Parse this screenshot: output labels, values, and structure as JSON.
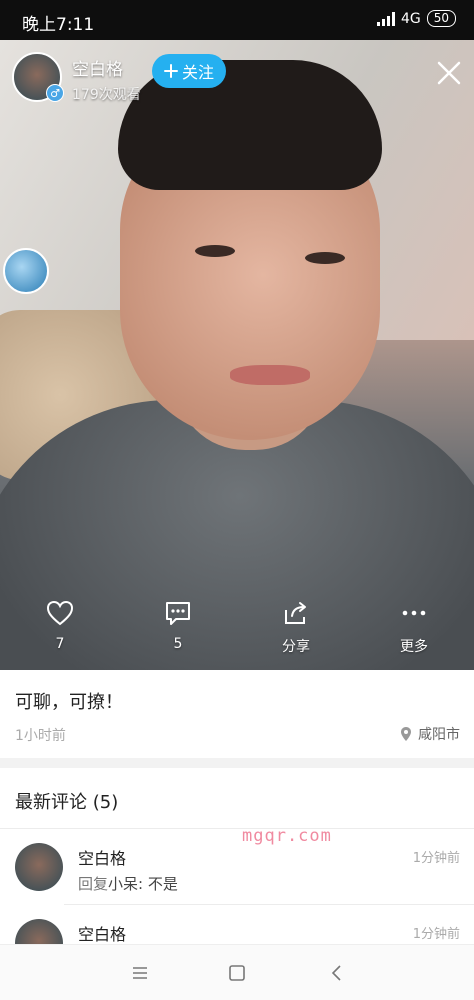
{
  "status_bar": {
    "time": "晚上7:11",
    "network": "4G",
    "battery": "50"
  },
  "poster": {
    "name": "空白格",
    "views": "179次观看",
    "gender_symbol": "♂",
    "follow_label": "关注"
  },
  "actions": {
    "like_count": "7",
    "comment_count": "5",
    "share_label": "分享",
    "more_label": "更多"
  },
  "post": {
    "text": "可聊，可撩！",
    "time": "1小时前",
    "location": "咸阳市"
  },
  "comments_header": "最新评论 (5)",
  "comments": [
    {
      "name": "空白格",
      "time": "1分钟前",
      "reply_prefix": "回复",
      "reply_to": "小呆",
      "text": ": 不是"
    },
    {
      "name": "空白格",
      "time": "1分钟前"
    }
  ],
  "watermark": "mgqr.com",
  "colors": {
    "accent": "#25b0f0",
    "watermark": "#f08aa0"
  },
  "icons": [
    "heart-icon",
    "comment-icon",
    "share-icon",
    "more-icon",
    "close-icon",
    "location-icon",
    "menu-icon",
    "home-icon",
    "back-icon"
  ]
}
